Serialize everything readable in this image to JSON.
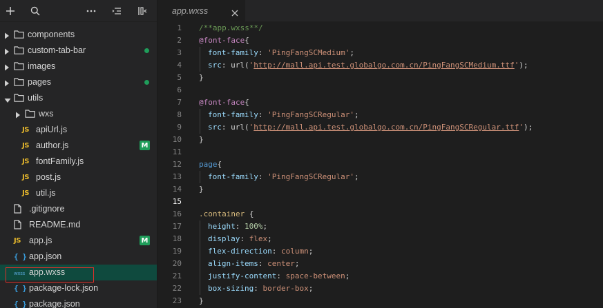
{
  "sidebar": {
    "toolbar": [
      "add-icon",
      "search-icon",
      "more-icon",
      "collapse-icon",
      "layout-icon"
    ],
    "tree": [
      {
        "label": "components",
        "type": "folder",
        "level": 0,
        "expanded": false,
        "status": ""
      },
      {
        "label": "custom-tab-bar",
        "type": "folder",
        "level": 0,
        "expanded": false,
        "status": "dot"
      },
      {
        "label": "images",
        "type": "folder",
        "level": 0,
        "expanded": false,
        "status": ""
      },
      {
        "label": "pages",
        "type": "folder",
        "level": 0,
        "expanded": false,
        "status": "dot"
      },
      {
        "label": "utils",
        "type": "folder",
        "level": 0,
        "expanded": true,
        "status": ""
      },
      {
        "label": "wxs",
        "type": "folder",
        "level": 1,
        "expanded": false,
        "status": ""
      },
      {
        "label": "apiUrl.js",
        "type": "js",
        "level": 1,
        "status": ""
      },
      {
        "label": "author.js",
        "type": "js",
        "level": 1,
        "status": "M"
      },
      {
        "label": "fontFamily.js",
        "type": "js",
        "level": 1,
        "status": ""
      },
      {
        "label": "post.js",
        "type": "js",
        "level": 1,
        "status": ""
      },
      {
        "label": "util.js",
        "type": "js",
        "level": 1,
        "status": ""
      },
      {
        "label": ".gitignore",
        "type": "file",
        "level": 0,
        "status": ""
      },
      {
        "label": "README.md",
        "type": "file",
        "level": 0,
        "status": ""
      },
      {
        "label": "app.js",
        "type": "js",
        "level": 0,
        "status": "M"
      },
      {
        "label": "app.json",
        "type": "json",
        "level": 0,
        "status": ""
      },
      {
        "label": "app.wxss",
        "type": "wxss",
        "level": 0,
        "status": "",
        "selected": true
      },
      {
        "label": "package-lock.json",
        "type": "json",
        "level": 0,
        "status": ""
      },
      {
        "label": "package.json",
        "type": "json",
        "level": 0,
        "status": ""
      }
    ],
    "icons": {
      "js": "JS",
      "json": "{ }",
      "wxss": "wxss"
    },
    "colors": {
      "modified": "#1f9d5a",
      "selected_bg": "#0f4a3e",
      "selection_outline": "#e0302a"
    }
  },
  "editor": {
    "tab": {
      "label": "app.wxss",
      "close_icon": "close-icon"
    },
    "active_line": 15,
    "lines": [
      {
        "n": "1",
        "indent": false,
        "tokens": [
          {
            "t": "/**app.wxss**/",
            "c": "comment"
          }
        ]
      },
      {
        "n": "2",
        "indent": false,
        "tokens": [
          {
            "t": "@font-face",
            "c": "at"
          },
          {
            "t": "{",
            "c": "punc"
          }
        ]
      },
      {
        "n": "3",
        "indent": true,
        "tokens": [
          {
            "t": "font-family",
            "c": "prop"
          },
          {
            "t": ": ",
            "c": "punc"
          },
          {
            "t": "'PingFangSCMedium'",
            "c": "str"
          },
          {
            "t": ";",
            "c": "punc"
          }
        ]
      },
      {
        "n": "4",
        "indent": true,
        "tokens": [
          {
            "t": "src",
            "c": "prop"
          },
          {
            "t": ": ",
            "c": "punc"
          },
          {
            "t": "url(",
            "c": "fn"
          },
          {
            "t": "'",
            "c": "str"
          },
          {
            "t": "http://mall.api.test.globalgo.com.cn/PingFangSCMedium.ttf",
            "c": "url"
          },
          {
            "t": "'",
            "c": "str"
          },
          {
            "t": ");",
            "c": "punc"
          }
        ]
      },
      {
        "n": "5",
        "indent": false,
        "tokens": [
          {
            "t": "}",
            "c": "punc"
          }
        ]
      },
      {
        "n": "6",
        "indent": false,
        "tokens": []
      },
      {
        "n": "7",
        "indent": false,
        "tokens": [
          {
            "t": "@font-face",
            "c": "at"
          },
          {
            "t": "{",
            "c": "punc"
          }
        ]
      },
      {
        "n": "8",
        "indent": true,
        "tokens": [
          {
            "t": "font-family",
            "c": "prop"
          },
          {
            "t": ": ",
            "c": "punc"
          },
          {
            "t": "'PingFangSCRegular'",
            "c": "str"
          },
          {
            "t": ";",
            "c": "punc"
          }
        ]
      },
      {
        "n": "9",
        "indent": true,
        "tokens": [
          {
            "t": "src",
            "c": "prop"
          },
          {
            "t": ": ",
            "c": "punc"
          },
          {
            "t": "url(",
            "c": "fn"
          },
          {
            "t": "'",
            "c": "str"
          },
          {
            "t": "http://mall.api.test.globalgo.com.cn/PingFangSCRegular.ttf",
            "c": "url"
          },
          {
            "t": "'",
            "c": "str"
          },
          {
            "t": ");",
            "c": "punc"
          }
        ]
      },
      {
        "n": "10",
        "indent": false,
        "tokens": [
          {
            "t": "}",
            "c": "punc"
          }
        ]
      },
      {
        "n": "11",
        "indent": false,
        "tokens": []
      },
      {
        "n": "12",
        "indent": false,
        "tokens": [
          {
            "t": "page",
            "c": "tag"
          },
          {
            "t": "{",
            "c": "punc"
          }
        ]
      },
      {
        "n": "13",
        "indent": true,
        "tokens": [
          {
            "t": "font-family",
            "c": "prop"
          },
          {
            "t": ": ",
            "c": "punc"
          },
          {
            "t": "'PingFangSCRegular'",
            "c": "str"
          },
          {
            "t": ";",
            "c": "punc"
          }
        ]
      },
      {
        "n": "14",
        "indent": false,
        "tokens": [
          {
            "t": "}",
            "c": "punc"
          }
        ]
      },
      {
        "n": "15",
        "indent": false,
        "tokens": []
      },
      {
        "n": "16",
        "indent": false,
        "tokens": [
          {
            "t": ".container",
            "c": "sel"
          },
          {
            "t": " {",
            "c": "punc"
          }
        ]
      },
      {
        "n": "17",
        "indent": true,
        "tokens": [
          {
            "t": "height",
            "c": "prop"
          },
          {
            "t": ": ",
            "c": "punc"
          },
          {
            "t": "100%",
            "c": "num"
          },
          {
            "t": ";",
            "c": "punc"
          }
        ]
      },
      {
        "n": "18",
        "indent": true,
        "tokens": [
          {
            "t": "display",
            "c": "prop"
          },
          {
            "t": ": ",
            "c": "punc"
          },
          {
            "t": "flex",
            "c": "val"
          },
          {
            "t": ";",
            "c": "punc"
          }
        ]
      },
      {
        "n": "19",
        "indent": true,
        "tokens": [
          {
            "t": "flex-direction",
            "c": "prop"
          },
          {
            "t": ": ",
            "c": "punc"
          },
          {
            "t": "column",
            "c": "val"
          },
          {
            "t": ";",
            "c": "punc"
          }
        ]
      },
      {
        "n": "20",
        "indent": true,
        "tokens": [
          {
            "t": "align-items",
            "c": "prop"
          },
          {
            "t": ": ",
            "c": "punc"
          },
          {
            "t": "center",
            "c": "val"
          },
          {
            "t": ";",
            "c": "punc"
          }
        ]
      },
      {
        "n": "21",
        "indent": true,
        "tokens": [
          {
            "t": "justify-content",
            "c": "prop"
          },
          {
            "t": ": ",
            "c": "punc"
          },
          {
            "t": "space-between",
            "c": "val"
          },
          {
            "t": ";",
            "c": "punc"
          }
        ]
      },
      {
        "n": "22",
        "indent": true,
        "tokens": [
          {
            "t": "box-sizing",
            "c": "prop"
          },
          {
            "t": ": ",
            "c": "punc"
          },
          {
            "t": "border-box",
            "c": "val"
          },
          {
            "t": ";",
            "c": "punc"
          }
        ]
      },
      {
        "n": "23",
        "indent": false,
        "tokens": [
          {
            "t": "}",
            "c": "punc"
          }
        ]
      }
    ]
  }
}
